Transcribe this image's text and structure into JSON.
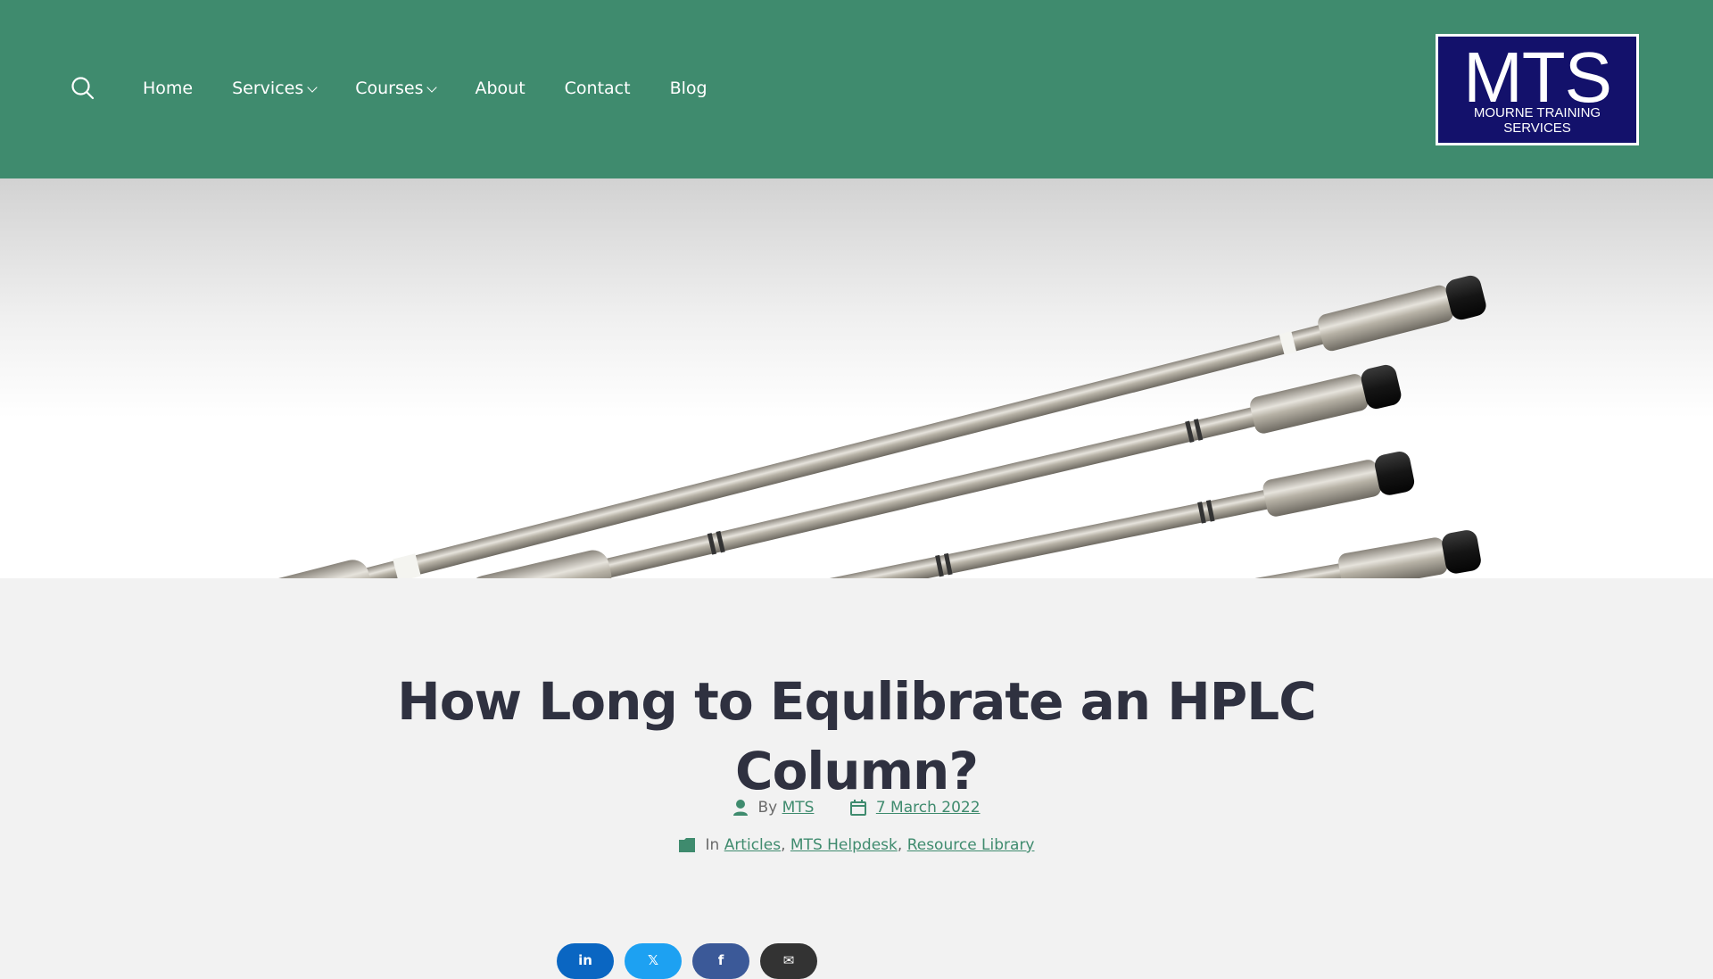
{
  "nav": {
    "items": [
      {
        "label": "Home"
      },
      {
        "label": "Services",
        "dropdown": true
      },
      {
        "label": "Courses",
        "dropdown": true
      },
      {
        "label": "About"
      },
      {
        "label": "Contact"
      },
      {
        "label": "Blog"
      }
    ]
  },
  "logo": {
    "big": "MTS",
    "small": "MOURNE TRAINING SERVICES"
  },
  "post": {
    "title": "How Long to Equlibrate an HPLC Column?",
    "by_label": "By",
    "author": "MTS",
    "date": "7 March 2022",
    "in_label": "In",
    "categories": [
      "Articles",
      "MTS Helpdesk",
      "Resource Library"
    ]
  },
  "share": {
    "buttons": [
      {
        "icon": "linkedin-icon",
        "glyph": "in",
        "color": "#0a66c2"
      },
      {
        "icon": "x-icon",
        "glyph": "𝕏",
        "color": "#1da1f2"
      },
      {
        "icon": "facebook-icon",
        "glyph": "f",
        "color": "#3b5998"
      },
      {
        "icon": "email-icon",
        "glyph": "✉",
        "color": "#333333"
      }
    ]
  },
  "colors": {
    "header": "#3f8b6e",
    "link": "#3f8b6e",
    "title": "#2f3140",
    "logo": "#13116b"
  }
}
